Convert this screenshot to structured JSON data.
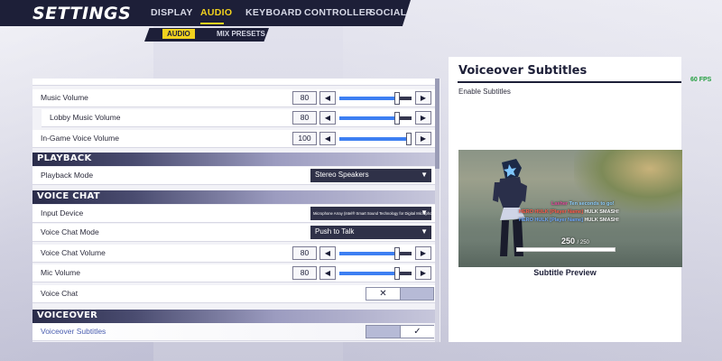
{
  "header": {
    "title": "SETTINGS",
    "tabs": [
      {
        "label": "DISPLAY",
        "active": false
      },
      {
        "label": "AUDIO",
        "active": true
      },
      {
        "label": "KEYBOARD",
        "active": false
      },
      {
        "label": "CONTROLLER",
        "active": false
      },
      {
        "label": "SOCIAL",
        "active": false
      }
    ]
  },
  "subtabs": [
    {
      "label": "AUDIO",
      "active": true
    },
    {
      "label": "MIX PRESETS",
      "active": false
    }
  ],
  "volume_rows": {
    "music": {
      "label": "Music Volume",
      "value": "80",
      "fraction": 0.8
    },
    "lobby": {
      "label": "Lobby Music Volume",
      "value": "80",
      "fraction": 0.8
    },
    "ingame_voice": {
      "label": "In-Game Voice Volume",
      "value": "100",
      "fraction": 1.0
    }
  },
  "arrows": {
    "left": "◀",
    "right": "▶"
  },
  "playback": {
    "header": "PLAYBACK",
    "mode_label": "Playback Mode",
    "mode_value": "Stereo Speakers"
  },
  "voice_chat": {
    "header": "VOICE CHAT",
    "input_device_label": "Input Device",
    "input_device_value": "Microphone Array (Intel® Smart Sound Technology for Digital Microphones)",
    "mode_label": "Voice Chat Mode",
    "mode_value": "Push to Talk",
    "volume_label": "Voice Chat Volume",
    "volume_value": "80",
    "volume_fraction": 0.8,
    "mic_label": "Mic Volume",
    "mic_value": "80",
    "mic_fraction": 0.8,
    "toggle_label": "Voice Chat",
    "toggle_symbol": "✕",
    "toggle_on": false
  },
  "voiceover": {
    "header": "VOICEOVER",
    "subtitles_label": "Voiceover Subtitles",
    "toggle_symbol": "✓",
    "toggle_on": true
  },
  "dropdown_arrow": "▼",
  "preview": {
    "title": "Voiceover Subtitles",
    "description": "Enable Subtitles",
    "caption": "Subtitle Preview",
    "subtitles": [
      {
        "speaker": "Lasher",
        "text": "Ten seconds to go!",
        "speaker_color": "#e04a9c",
        "text_color": "#8fd0ff"
      },
      {
        "speaker": "HERO HULK",
        "tag": "[Player Name]",
        "text": "HULK SMASH!",
        "speaker_color": "#ff5a4a",
        "tag_color": "#ff5a4a",
        "text_color": "#ffffff"
      },
      {
        "speaker": "HERO HULK",
        "tag": "[Player Name]",
        "text": "HULK SMASH!",
        "speaker_color": "#6fa8ff",
        "tag_color": "#6fa8ff",
        "text_color": "#ffffff"
      }
    ],
    "hp_current": "250",
    "hp_max": "/ 250",
    "hp_fraction": 1.0
  },
  "fps": "60 FPS",
  "colors": {
    "accent_yellow": "#f2d21e",
    "navy": "#1d1f38",
    "slider_blue": "#3d7ff2",
    "fps_green": "#1f9d3c"
  },
  "scroll_position": 0.0
}
